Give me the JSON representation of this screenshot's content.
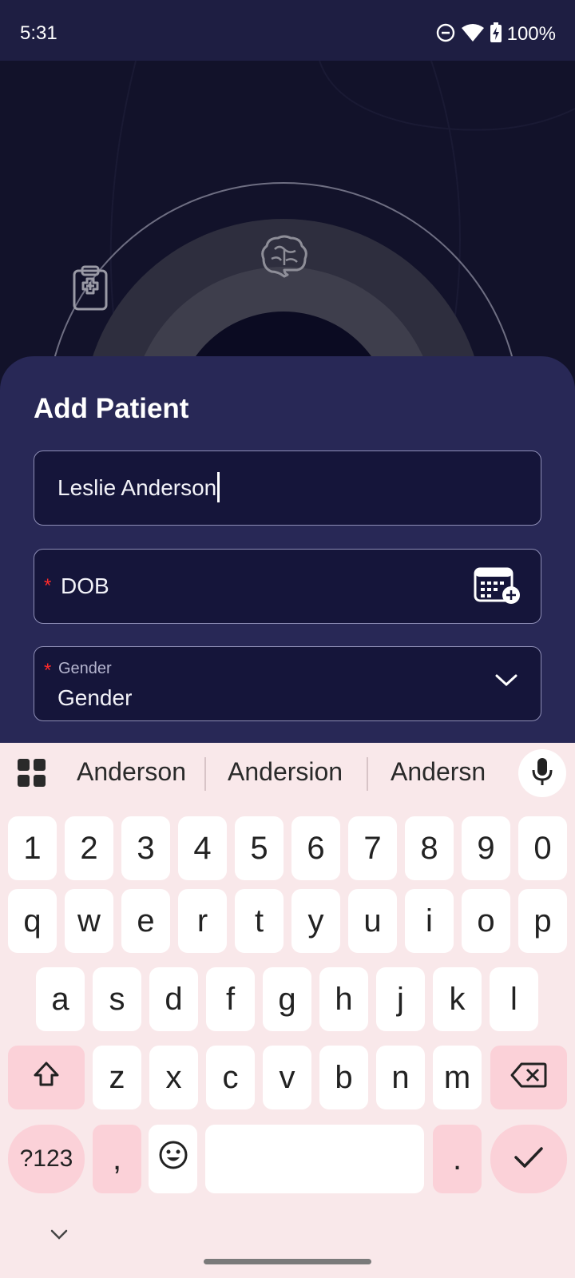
{
  "status_bar": {
    "time": "5:31",
    "battery": "100%"
  },
  "sheet": {
    "title": "Add Patient",
    "name_field": {
      "value": "Leslie Anderson"
    },
    "dob_field": {
      "required_marker": "*",
      "label": "DOB"
    },
    "gender_field": {
      "required_marker": "*",
      "small_label": "Gender",
      "value": "Gender"
    }
  },
  "keyboard": {
    "suggestions": [
      "Anderson",
      "Andersion",
      "Andersn"
    ],
    "row_numbers": [
      "1",
      "2",
      "3",
      "4",
      "5",
      "6",
      "7",
      "8",
      "9",
      "0"
    ],
    "row_top": [
      "q",
      "w",
      "e",
      "r",
      "t",
      "y",
      "u",
      "i",
      "o",
      "p"
    ],
    "row_middle": [
      "a",
      "s",
      "d",
      "f",
      "g",
      "h",
      "j",
      "k",
      "l"
    ],
    "row_bottom": [
      "z",
      "x",
      "c",
      "v",
      "b",
      "n",
      "m"
    ],
    "symbols_key": "?123",
    "comma_key": ",",
    "period_key": "."
  },
  "colors": {
    "status_bar_bg": "#1e1e42",
    "sheet_bg": "#282856",
    "field_bg": "#15153a",
    "required": "#ff2a2a",
    "keyboard_bg": "#f9e8ea",
    "modifier_key": "#fbd1d8"
  },
  "icons": [
    "dnd-icon",
    "wifi-icon",
    "battery-icon",
    "clipboard-plus-icon",
    "brain-icon",
    "calendar-plus-icon",
    "chevron-down-icon",
    "apps-grid-icon",
    "mic-icon",
    "shift-icon",
    "backspace-icon",
    "emoji-icon",
    "check-icon",
    "keyboard-hide-icon"
  ]
}
